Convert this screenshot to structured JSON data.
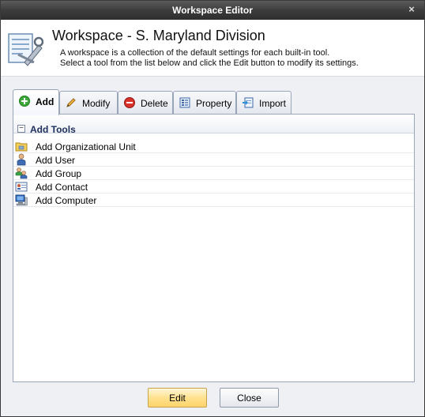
{
  "window": {
    "title": "Workspace Editor",
    "close_glyph": "×"
  },
  "header": {
    "title": "Workspace - S. Maryland Division",
    "description_line1": "A workspace is a collection of the default settings for each built-in tool.",
    "description_line2": "Select a tool from the list below and click the Edit button to modify its settings.",
    "icon": "workspace-tools-icon"
  },
  "tabs": [
    {
      "label": "Add",
      "icon": "add-plus-icon",
      "active": true
    },
    {
      "label": "Modify",
      "icon": "pencil-icon",
      "active": false
    },
    {
      "label": "Delete",
      "icon": "delete-minus-icon",
      "active": false
    },
    {
      "label": "Property",
      "icon": "property-sheet-icon",
      "active": false
    },
    {
      "label": "Import",
      "icon": "import-icon",
      "active": false
    }
  ],
  "group": {
    "label": "Add Tools",
    "toggle_glyph": "−"
  },
  "items": [
    {
      "label": "Add Organizational Unit",
      "icon": "organizational-unit-icon"
    },
    {
      "label": "Add User",
      "icon": "user-icon"
    },
    {
      "label": "Add Group",
      "icon": "group-icon"
    },
    {
      "label": "Add Contact",
      "icon": "contact-card-icon"
    },
    {
      "label": "Add Computer",
      "icon": "computer-icon"
    }
  ],
  "buttons": {
    "edit": "Edit",
    "close": "Close"
  },
  "colors": {
    "titlebar": "#3d3d3d",
    "accent_button": "#ffd46b",
    "group_label": "#1d2f5a"
  }
}
